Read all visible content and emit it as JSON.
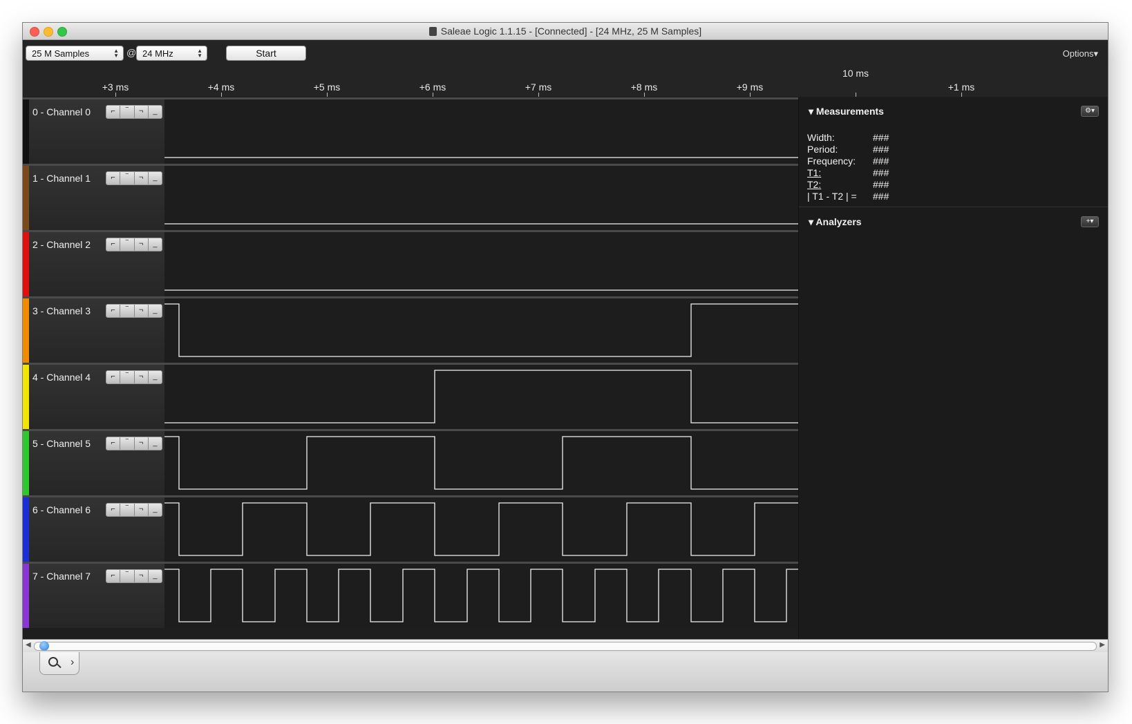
{
  "window": {
    "title": "Saleae Logic 1.1.15 - [Connected] - [24 MHz, 25 M Samples]"
  },
  "toolbar": {
    "samples_value": "25 M Samples",
    "at": "@",
    "rate_value": "24 MHz",
    "start_label": "Start",
    "options_label": "Options▾"
  },
  "ruler": {
    "labels": [
      "+3 ms",
      "+4 ms",
      "+5 ms",
      "+6 ms",
      "+7 ms",
      "+8 ms",
      "+9 ms",
      "+1 ms"
    ],
    "major_label": "10 ms"
  },
  "channels": [
    {
      "name": "0 - Channel 0",
      "color": "#111111"
    },
    {
      "name": "1 - Channel 1",
      "color": "#7a4a1c"
    },
    {
      "name": "2 - Channel 2",
      "color": "#e01010"
    },
    {
      "name": "3 - Channel 3",
      "color": "#f08a00"
    },
    {
      "name": "4 - Channel 4",
      "color": "#f2e600"
    },
    {
      "name": "5 - Channel 5",
      "color": "#2ec82e"
    },
    {
      "name": "6 - Channel 6",
      "color": "#1a2fd6"
    },
    {
      "name": "7 - Channel 7",
      "color": "#8a35d6"
    }
  ],
  "trigger_icons": [
    "rising-edge-icon",
    "high-level-icon",
    "falling-edge-icon",
    "low-level-icon"
  ],
  "measurements": {
    "header": "Measurements",
    "rows": [
      {
        "label": "Width:",
        "value": "###"
      },
      {
        "label": "Period:",
        "value": "###"
      },
      {
        "label": "Frequency:",
        "value": "###"
      },
      {
        "label": "T1:",
        "value": "###"
      },
      {
        "label": "T2:",
        "value": "###"
      },
      {
        "label": "| T1 - T2 | =",
        "value": "###"
      }
    ]
  },
  "analyzers": {
    "header": "Analyzers"
  }
}
